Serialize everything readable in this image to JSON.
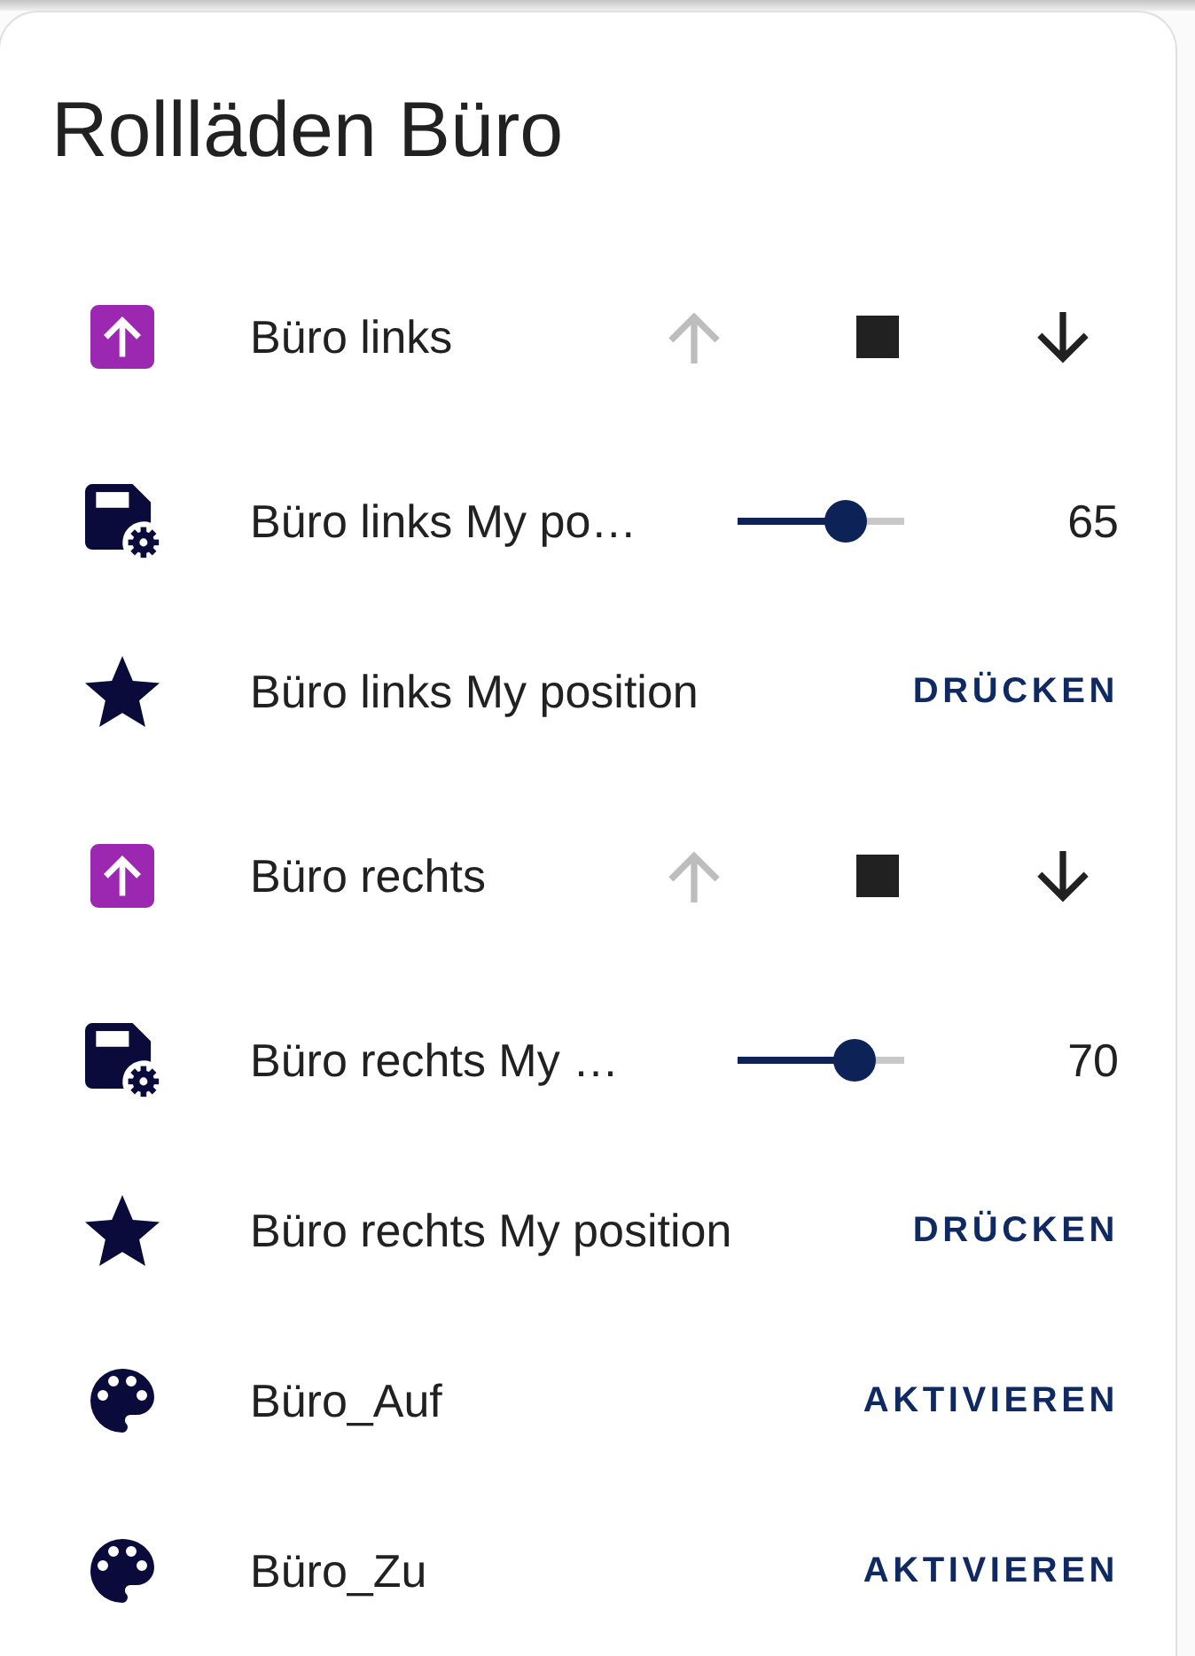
{
  "card": {
    "title": "Rollläden Büro"
  },
  "rows": [
    {
      "kind": "cover",
      "name": "Büro links",
      "controls": [
        {
          "kind": "up",
          "disabled": true
        },
        {
          "kind": "stop",
          "disabled": false
        },
        {
          "kind": "down",
          "disabled": false
        }
      ]
    },
    {
      "kind": "number",
      "name": "Büro links My po…",
      "level": 0.65,
      "reading": "65"
    },
    {
      "kind": "button",
      "name": "Büro links My position",
      "action": "DRÜCKEN"
    },
    {
      "kind": "cover",
      "name": "Büro rechts",
      "controls": [
        {
          "kind": "up",
          "disabled": true
        },
        {
          "kind": "stop",
          "disabled": false
        },
        {
          "kind": "down",
          "disabled": false
        }
      ]
    },
    {
      "kind": "number",
      "name": "Büro rechts My …",
      "level": 0.7,
      "reading": "70"
    },
    {
      "kind": "button",
      "name": "Büro rechts My position",
      "action": "DRÜCKEN"
    },
    {
      "kind": "scene",
      "name": "Büro_Auf",
      "action": "AKTIVIEREN"
    },
    {
      "kind": "scene",
      "name": "Büro_Zu",
      "action": "AKTIVIEREN"
    }
  ]
}
